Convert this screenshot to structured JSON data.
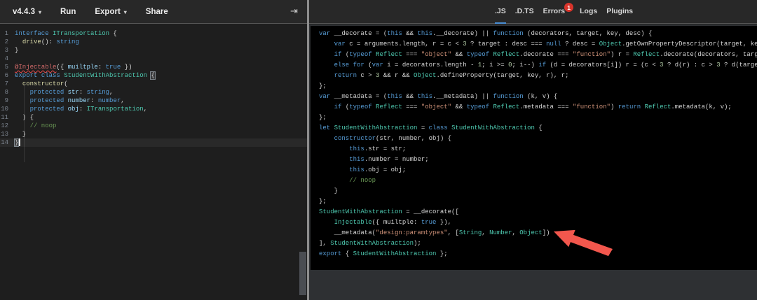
{
  "colors": {
    "header-bg": "#282828",
    "editor-bg": "#1e1e1e",
    "sidebar-bg": "#2e3033",
    "tab-underline": "#4a8fd4",
    "badge-bg": "#d9342b",
    "gutter-fg": "#7d8590",
    "kw": "#569cd6",
    "type": "#4ec9b0",
    "str": "#ce9178",
    "num": "#b5cea8",
    "com": "#6a9955",
    "txt": "#d4d4d4",
    "prop": "#9cdcfe",
    "fn": "#dcdcaa",
    "err": "#d16969",
    "arrow": "#f2574d"
  },
  "header": {
    "version_label": "v4.4.3",
    "version_caret": "▾",
    "run_label": "Run",
    "export_label": "Export",
    "export_caret": "▾",
    "share_label": "Share",
    "collapse_icon": "⇥",
    "tabs": [
      {
        "label": ".JS",
        "active": true
      },
      {
        "label": ".D.TS",
        "active": false
      },
      {
        "label": "Errors",
        "active": false,
        "badge": "1"
      },
      {
        "label": "Logs",
        "active": false
      },
      {
        "label": "Plugins",
        "active": false
      }
    ]
  },
  "editor": {
    "lines": [
      {
        "num": "1",
        "segments": [
          {
            "t": "interface ",
            "c": "kw"
          },
          {
            "t": "ITransportation",
            "c": "type"
          },
          {
            "t": " {",
            "c": "txt"
          }
        ]
      },
      {
        "num": "2",
        "segments": [
          {
            "t": "  ",
            "c": "txt"
          },
          {
            "t": "drive",
            "c": "fn"
          },
          {
            "t": "(): ",
            "c": "txt"
          },
          {
            "t": "string",
            "c": "kw"
          }
        ]
      },
      {
        "num": "3",
        "segments": [
          {
            "t": "}",
            "c": "txt"
          }
        ]
      },
      {
        "num": "4",
        "segments": []
      },
      {
        "num": "5",
        "segments": [
          {
            "t": "@Injectable",
            "c": "err",
            "u": true
          },
          {
            "t": "({ ",
            "c": "txt"
          },
          {
            "t": "muiltple",
            "c": "prop"
          },
          {
            "t": ": ",
            "c": "txt"
          },
          {
            "t": "true",
            "c": "kw"
          },
          {
            "t": " })",
            "c": "txt"
          }
        ]
      },
      {
        "num": "6",
        "segments": [
          {
            "t": "export",
            "c": "kw"
          },
          {
            "t": " ",
            "c": "txt"
          },
          {
            "t": "class",
            "c": "kw"
          },
          {
            "t": " ",
            "c": "txt"
          },
          {
            "t": "StudentWithAbstraction",
            "c": "type"
          },
          {
            "t": " ",
            "c": "txt"
          },
          {
            "t": "{",
            "c": "txt",
            "box": true
          }
        ]
      },
      {
        "num": "7",
        "segments": [
          {
            "t": "  ",
            "c": "txt"
          },
          {
            "t": "constructor",
            "c": "fn"
          },
          {
            "t": "(",
            "c": "txt"
          }
        ]
      },
      {
        "num": "8",
        "segments": [
          {
            "t": "    ",
            "c": "txt"
          },
          {
            "t": "protected",
            "c": "kw"
          },
          {
            "t": " ",
            "c": "txt"
          },
          {
            "t": "str",
            "c": "prop"
          },
          {
            "t": ": ",
            "c": "txt"
          },
          {
            "t": "string",
            "c": "kw"
          },
          {
            "t": ",",
            "c": "txt"
          }
        ]
      },
      {
        "num": "9",
        "segments": [
          {
            "t": "    ",
            "c": "txt"
          },
          {
            "t": "protected",
            "c": "kw"
          },
          {
            "t": " ",
            "c": "txt"
          },
          {
            "t": "number",
            "c": "prop"
          },
          {
            "t": ": ",
            "c": "txt"
          },
          {
            "t": "number",
            "c": "kw"
          },
          {
            "t": ",",
            "c": "txt"
          }
        ]
      },
      {
        "num": "10",
        "segments": [
          {
            "t": "    ",
            "c": "txt"
          },
          {
            "t": "protected",
            "c": "kw"
          },
          {
            "t": " ",
            "c": "txt"
          },
          {
            "t": "obj",
            "c": "prop"
          },
          {
            "t": ": ",
            "c": "txt"
          },
          {
            "t": "ITransportation",
            "c": "type"
          },
          {
            "t": ",",
            "c": "txt"
          }
        ]
      },
      {
        "num": "11",
        "segments": [
          {
            "t": "  ) {",
            "c": "txt"
          }
        ]
      },
      {
        "num": "12",
        "segments": [
          {
            "t": "    ",
            "c": "txt"
          },
          {
            "t": "// noop",
            "c": "com"
          }
        ]
      },
      {
        "num": "13",
        "segments": [
          {
            "t": "  }",
            "c": "txt"
          }
        ]
      },
      {
        "num": "14",
        "current": true,
        "cursorAfter": true,
        "segments": [
          {
            "t": "}",
            "c": "txt",
            "box": true
          }
        ]
      }
    ]
  },
  "output": {
    "lines": [
      {
        "segments": [
          {
            "t": "var",
            "c": "kw"
          },
          {
            "t": " __decorate = (",
            "c": "txt"
          },
          {
            "t": "this",
            "c": "kw"
          },
          {
            "t": " && ",
            "c": "txt"
          },
          {
            "t": "this",
            "c": "kw"
          },
          {
            "t": ".__decorate) || ",
            "c": "txt"
          },
          {
            "t": "function",
            "c": "kw"
          },
          {
            "t": " (decorators, target, key, desc) {",
            "c": "txt"
          }
        ]
      },
      {
        "segments": [
          {
            "t": "    ",
            "c": "txt"
          },
          {
            "t": "var",
            "c": "kw"
          },
          {
            "t": " c = arguments.length, r = c < ",
            "c": "txt"
          },
          {
            "t": "3",
            "c": "num"
          },
          {
            "t": " ? target : desc === ",
            "c": "txt"
          },
          {
            "t": "null",
            "c": "kw"
          },
          {
            "t": " ? desc = ",
            "c": "txt"
          },
          {
            "t": "Object",
            "c": "type"
          },
          {
            "t": ".getOwnPropertyDescriptor(target, key) : desc, d;",
            "c": "txt"
          }
        ]
      },
      {
        "segments": [
          {
            "t": "    ",
            "c": "txt"
          },
          {
            "t": "if",
            "c": "kw"
          },
          {
            "t": " (",
            "c": "txt"
          },
          {
            "t": "typeof",
            "c": "kw"
          },
          {
            "t": " ",
            "c": "txt"
          },
          {
            "t": "Reflect",
            "c": "type"
          },
          {
            "t": " === ",
            "c": "txt"
          },
          {
            "t": "\"object\"",
            "c": "str"
          },
          {
            "t": " && ",
            "c": "txt"
          },
          {
            "t": "typeof",
            "c": "kw"
          },
          {
            "t": " ",
            "c": "txt"
          },
          {
            "t": "Reflect",
            "c": "type"
          },
          {
            "t": ".decorate === ",
            "c": "txt"
          },
          {
            "t": "\"function\"",
            "c": "str"
          },
          {
            "t": ") r = ",
            "c": "txt"
          },
          {
            "t": "Reflect",
            "c": "type"
          },
          {
            "t": ".decorate(decorators, target, key, desc);",
            "c": "txt"
          }
        ]
      },
      {
        "segments": [
          {
            "t": "    ",
            "c": "txt"
          },
          {
            "t": "else",
            "c": "kw"
          },
          {
            "t": " ",
            "c": "txt"
          },
          {
            "t": "for",
            "c": "kw"
          },
          {
            "t": " (",
            "c": "txt"
          },
          {
            "t": "var",
            "c": "kw"
          },
          {
            "t": " i = decorators.length - ",
            "c": "txt"
          },
          {
            "t": "1",
            "c": "num"
          },
          {
            "t": "; i >= ",
            "c": "txt"
          },
          {
            "t": "0",
            "c": "num"
          },
          {
            "t": "; i--) ",
            "c": "txt"
          },
          {
            "t": "if",
            "c": "kw"
          },
          {
            "t": " (d = decorators[i]) r = (c < ",
            "c": "txt"
          },
          {
            "t": "3",
            "c": "num"
          },
          {
            "t": " ? d(r) : c > ",
            "c": "txt"
          },
          {
            "t": "3",
            "c": "num"
          },
          {
            "t": " ? d(target, key, r) : d(target, key)) || r;",
            "c": "txt"
          }
        ]
      },
      {
        "segments": [
          {
            "t": "    ",
            "c": "txt"
          },
          {
            "t": "return",
            "c": "kw"
          },
          {
            "t": " c > ",
            "c": "txt"
          },
          {
            "t": "3",
            "c": "num"
          },
          {
            "t": " && r && ",
            "c": "txt"
          },
          {
            "t": "Object",
            "c": "type"
          },
          {
            "t": ".defineProperty(target, key, r), r;",
            "c": "txt"
          }
        ]
      },
      {
        "segments": [
          {
            "t": "};",
            "c": "txt"
          }
        ]
      },
      {
        "segments": [
          {
            "t": "var",
            "c": "kw"
          },
          {
            "t": " __metadata = (",
            "c": "txt"
          },
          {
            "t": "this",
            "c": "kw"
          },
          {
            "t": " && ",
            "c": "txt"
          },
          {
            "t": "this",
            "c": "kw"
          },
          {
            "t": ".__metadata) || ",
            "c": "txt"
          },
          {
            "t": "function",
            "c": "kw"
          },
          {
            "t": " (k, v) {",
            "c": "txt"
          }
        ]
      },
      {
        "segments": [
          {
            "t": "    ",
            "c": "txt"
          },
          {
            "t": "if",
            "c": "kw"
          },
          {
            "t": " (",
            "c": "txt"
          },
          {
            "t": "typeof",
            "c": "kw"
          },
          {
            "t": " ",
            "c": "txt"
          },
          {
            "t": "Reflect",
            "c": "type"
          },
          {
            "t": " === ",
            "c": "txt"
          },
          {
            "t": "\"object\"",
            "c": "str"
          },
          {
            "t": " && ",
            "c": "txt"
          },
          {
            "t": "typeof",
            "c": "kw"
          },
          {
            "t": " ",
            "c": "txt"
          },
          {
            "t": "Reflect",
            "c": "type"
          },
          {
            "t": ".metadata === ",
            "c": "txt"
          },
          {
            "t": "\"function\"",
            "c": "str"
          },
          {
            "t": ") ",
            "c": "txt"
          },
          {
            "t": "return",
            "c": "kw"
          },
          {
            "t": " ",
            "c": "txt"
          },
          {
            "t": "Reflect",
            "c": "type"
          },
          {
            "t": ".metadata(k, v);",
            "c": "txt"
          }
        ]
      },
      {
        "segments": [
          {
            "t": "};",
            "c": "txt"
          }
        ]
      },
      {
        "segments": [
          {
            "t": "let",
            "c": "kw"
          },
          {
            "t": " ",
            "c": "txt"
          },
          {
            "t": "StudentWithAbstraction",
            "c": "type"
          },
          {
            "t": " = ",
            "c": "txt"
          },
          {
            "t": "class",
            "c": "kw"
          },
          {
            "t": " ",
            "c": "txt"
          },
          {
            "t": "StudentWithAbstraction",
            "c": "type"
          },
          {
            "t": " {",
            "c": "txt"
          }
        ]
      },
      {
        "segments": [
          {
            "t": "    ",
            "c": "txt"
          },
          {
            "t": "constructor",
            "c": "kw"
          },
          {
            "t": "(str, number, obj) {",
            "c": "txt"
          }
        ]
      },
      {
        "segments": [
          {
            "t": "        ",
            "c": "txt"
          },
          {
            "t": "this",
            "c": "kw"
          },
          {
            "t": ".str = str;",
            "c": "txt"
          }
        ]
      },
      {
        "segments": [
          {
            "t": "        ",
            "c": "txt"
          },
          {
            "t": "this",
            "c": "kw"
          },
          {
            "t": ".number = number;",
            "c": "txt"
          }
        ]
      },
      {
        "segments": [
          {
            "t": "        ",
            "c": "txt"
          },
          {
            "t": "this",
            "c": "kw"
          },
          {
            "t": ".obj = obj;",
            "c": "txt"
          }
        ]
      },
      {
        "segments": [
          {
            "t": "        ",
            "c": "txt"
          },
          {
            "t": "// noop",
            "c": "com"
          }
        ]
      },
      {
        "segments": [
          {
            "t": "    }",
            "c": "txt"
          }
        ]
      },
      {
        "segments": [
          {
            "t": "};",
            "c": "txt"
          }
        ]
      },
      {
        "segments": [
          {
            "t": "StudentWithAbstraction",
            "c": "type"
          },
          {
            "t": " = __decorate([",
            "c": "txt"
          }
        ]
      },
      {
        "segments": [
          {
            "t": "    ",
            "c": "txt"
          },
          {
            "t": "Injectable",
            "c": "type"
          },
          {
            "t": "({ muiltple: ",
            "c": "txt"
          },
          {
            "t": "true",
            "c": "kw"
          },
          {
            "t": " }),",
            "c": "txt"
          }
        ]
      },
      {
        "segments": [
          {
            "t": "    __metadata(",
            "c": "txt"
          },
          {
            "t": "\"design:paramtypes\"",
            "c": "str"
          },
          {
            "t": ", [",
            "c": "txt"
          },
          {
            "t": "String",
            "c": "type"
          },
          {
            "t": ", ",
            "c": "txt"
          },
          {
            "t": "Number",
            "c": "type"
          },
          {
            "t": ", ",
            "c": "txt"
          },
          {
            "t": "Object",
            "c": "type"
          },
          {
            "t": "])",
            "c": "txt"
          }
        ]
      },
      {
        "segments": [
          {
            "t": "], ",
            "c": "txt"
          },
          {
            "t": "StudentWithAbstraction",
            "c": "type"
          },
          {
            "t": ");",
            "c": "txt"
          }
        ]
      },
      {
        "segments": [
          {
            "t": "export",
            "c": "kw"
          },
          {
            "t": " { ",
            "c": "txt"
          },
          {
            "t": "StudentWithAbstraction",
            "c": "type"
          },
          {
            "t": " };",
            "c": "txt"
          }
        ]
      }
    ]
  }
}
